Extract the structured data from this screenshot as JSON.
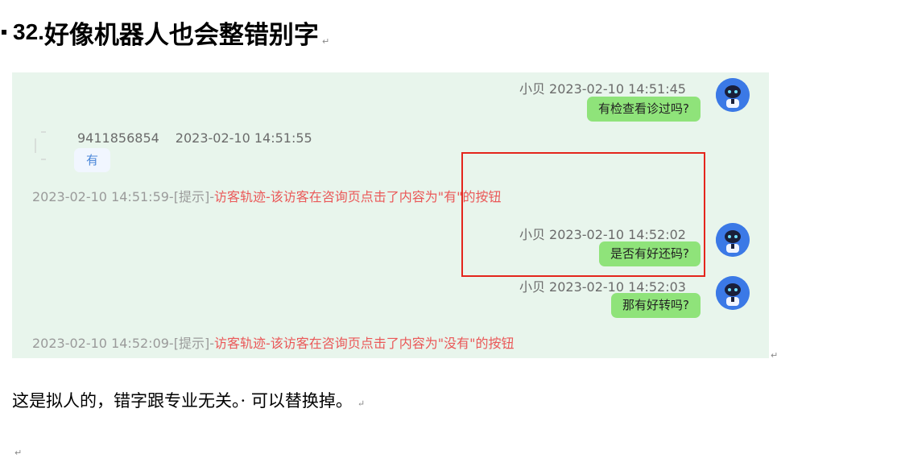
{
  "heading": {
    "number": "32.",
    "text": "好像机器人也会整错别字",
    "para_mark": "↵"
  },
  "chat": {
    "messages": [
      {
        "meta": "小贝 2023-02-10 14:51:45",
        "text": "有检查看诊过吗?"
      },
      {
        "meta_id": "9411856854",
        "meta_time": "2023-02-10 14:51:55",
        "text": "有"
      },
      {
        "meta": "小贝 2023-02-10 14:52:02",
        "text": "是否有好还码?"
      },
      {
        "meta": "小贝 2023-02-10 14:52:03",
        "text": "那有好转吗?"
      }
    ],
    "system_notes": [
      {
        "prefix": "2023-02-10 14:51:59-[提示]-",
        "content": "访客轨迹-该访客在咨询页点击了内容为\"有\"的按钮"
      },
      {
        "prefix": "2023-02-10 14:52:09-[提示]-",
        "content": "访客轨迹-该访客在咨询页点击了内容为\"没有\"的按钮"
      }
    ],
    "colors": {
      "background": "#e8f5ec",
      "bubble_agent": "#8fe37a",
      "highlight_box": "#e4251c",
      "note_red": "#ea5858"
    }
  },
  "body": {
    "text": "这是拟人的，错字跟专业无关。· 可以替换掉。",
    "para_mark": "↵"
  },
  "empty_para_mark": "↵",
  "image_para_mark": "↵"
}
